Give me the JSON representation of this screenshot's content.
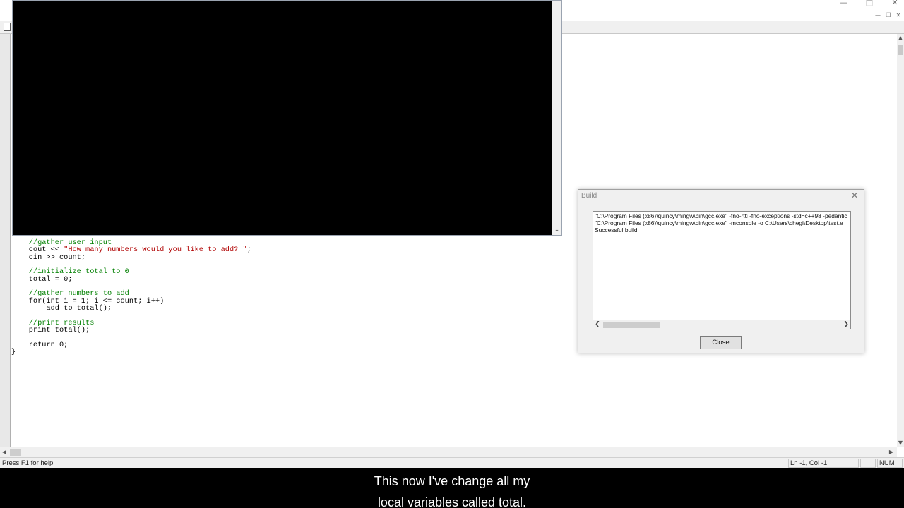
{
  "editor": {
    "code_lines": [
      "    //gather user input",
      "    cout << \"How many numbers would you like to add? \";",
      "    cin >> count;",
      "",
      "    //initialize total to 0",
      "    total = 0;",
      "",
      "    //gather numbers to add",
      "    for(int i = 1; i <= count; i++)",
      "        add_to_total();",
      "",
      "    //print results",
      "    print_total();",
      "",
      "    return 0;",
      "}"
    ]
  },
  "status_bar": {
    "help_text": "Press F1 for help",
    "cursor_position": "Ln -1, Col -1",
    "num_lock": "NUM"
  },
  "build_dialog": {
    "title": "Build",
    "output_lines": [
      "\"C:\\Program Files (x86)\\quincy\\mingw\\bin\\gcc.exe\" -fno-rtti -fno-exceptions -std=c++98 -pedantic",
      "\"C:\\Program Files (x86)\\quincy\\mingw\\bin\\gcc.exe\" -mconsole -o C:\\Users\\chegi\\Desktop\\test.e",
      "Successful build"
    ],
    "close_label": "Close"
  },
  "subtitles": {
    "line1": "This now I've change all my",
    "line2": "local variables called total."
  },
  "icons": {
    "minimize": "minimize-icon",
    "maximize": "maximize-icon",
    "close": "close-icon",
    "new_document": "new-document-icon"
  },
  "colors": {
    "comment": "#008000",
    "string": "#b00000",
    "console_background": "#000000"
  }
}
